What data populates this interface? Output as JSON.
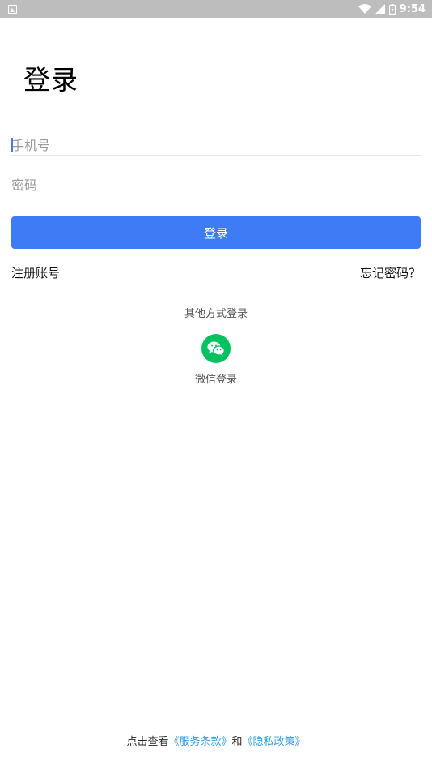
{
  "status_bar": {
    "time": "9:54",
    "icons": [
      "notification-icon",
      "wifi-icon",
      "signal-icon",
      "battery-icon"
    ]
  },
  "page": {
    "title": "登录"
  },
  "form": {
    "phone_placeholder": "手机号",
    "phone_value": "",
    "password_placeholder": "密码",
    "password_value": "",
    "login_label": "登录"
  },
  "links": {
    "register": "注册账号",
    "forgot": "忘记密码？"
  },
  "other_login": {
    "label": "其他方式登录",
    "wechat_label": "微信登录"
  },
  "terms": {
    "prefix": "点击查看",
    "service": "《服务条款》",
    "and": "和",
    "privacy": "《隐私政策》"
  },
  "colors": {
    "primary": "#3d7cf5",
    "wechat": "#07c160",
    "link": "#2f9be0",
    "status_bar": "#bdbdbd"
  }
}
